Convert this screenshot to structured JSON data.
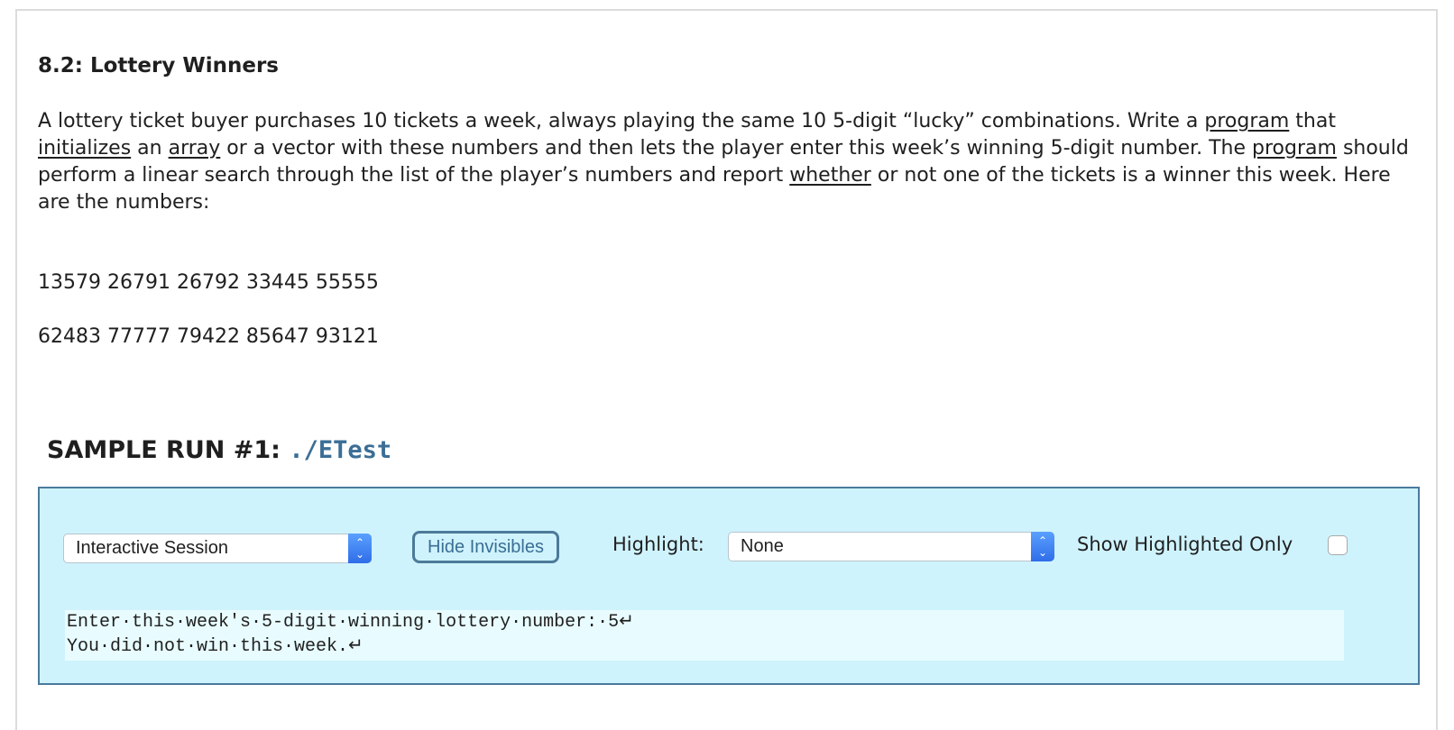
{
  "problem": {
    "title": "8.2: Lottery Winners",
    "paragraph": [
      {
        "text": "A lottery ticket buyer purchases 10 tickets a week, always playing the same 10 5-digit “lucky” combinations. Write a ",
        "link": false
      },
      {
        "text": "program",
        "link": true
      },
      {
        "text": " that ",
        "link": false
      },
      {
        "text": "initializes",
        "link": true
      },
      {
        "text": " an ",
        "link": false
      },
      {
        "text": "array",
        "link": true
      },
      {
        "text": " or a vector with these numbers and then lets the player enter this week’s winning 5-digit number. The ",
        "link": false
      },
      {
        "text": "program",
        "link": true
      },
      {
        "text": " should perform a linear search through the list of the player’s numbers and report ",
        "link": false
      },
      {
        "text": "whether",
        "link": true
      },
      {
        "text": " or not one of the tickets is a winner this week. Here are the numbers:",
        "link": false
      }
    ],
    "number_rows": [
      "13579 26791 26792 33445 55555",
      "62483 77777 79422 85647 93121"
    ]
  },
  "sample_run": {
    "heading": "SAMPLE RUN #1:",
    "command": "./ETest",
    "mode_select": {
      "selected": "Interactive Session"
    },
    "hide_invisibles_label": "Hide Invisibles",
    "highlight_label": "Highlight:",
    "highlight_select": {
      "selected": "None"
    },
    "show_highlighted_only_label": "Show Highlighted Only",
    "show_highlighted_only_checked": false,
    "output_lines": [
      "Enter·this·week's·5-digit·winning·lottery·number:·5↵",
      "You·did·not·win·this·week.↵"
    ]
  },
  "colors": {
    "box_bg": "#cff3fd",
    "box_border": "#4a7a9c",
    "terminal_bg": "#e8fcff",
    "command_color": "#3b6e95"
  }
}
